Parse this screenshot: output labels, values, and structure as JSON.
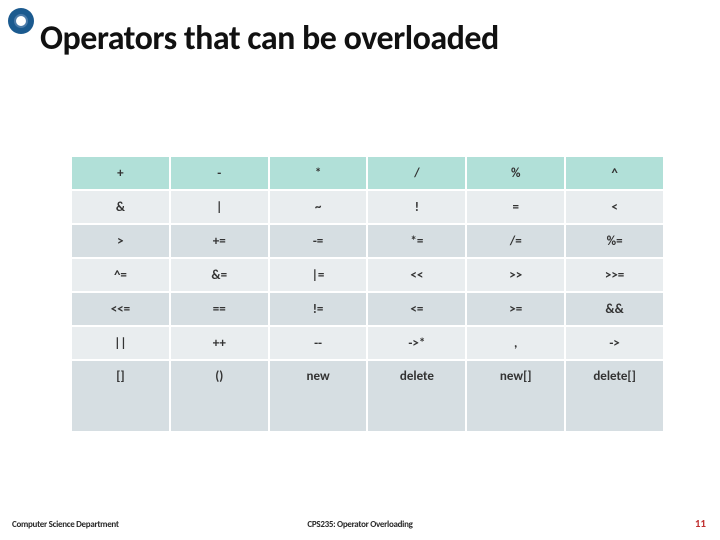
{
  "title": "Operators that can be overloaded",
  "chart_data": {
    "type": "table",
    "title": "Operators that can be overloaded",
    "columns": 6,
    "rows": [
      [
        "+",
        "-",
        "*",
        "/",
        "%",
        "^"
      ],
      [
        "&",
        "|",
        "~",
        "!",
        "=",
        "<"
      ],
      [
        ">",
        "+=",
        "-=",
        "*=",
        "/=",
        "%="
      ],
      [
        "^=",
        "&=",
        "|=",
        "<<",
        ">>",
        ">>="
      ],
      [
        "<<=",
        "==",
        "!=",
        "<=",
        ">=",
        "&&"
      ],
      [
        "||",
        "++",
        "--",
        "->*",
        ",",
        "->"
      ],
      [
        "[]",
        "()",
        "new",
        "delete",
        "new[]",
        "delete[]"
      ]
    ]
  },
  "footer": {
    "left": "Computer Science Department",
    "center": "CPS235: Operator Overloading",
    "right": "11"
  }
}
